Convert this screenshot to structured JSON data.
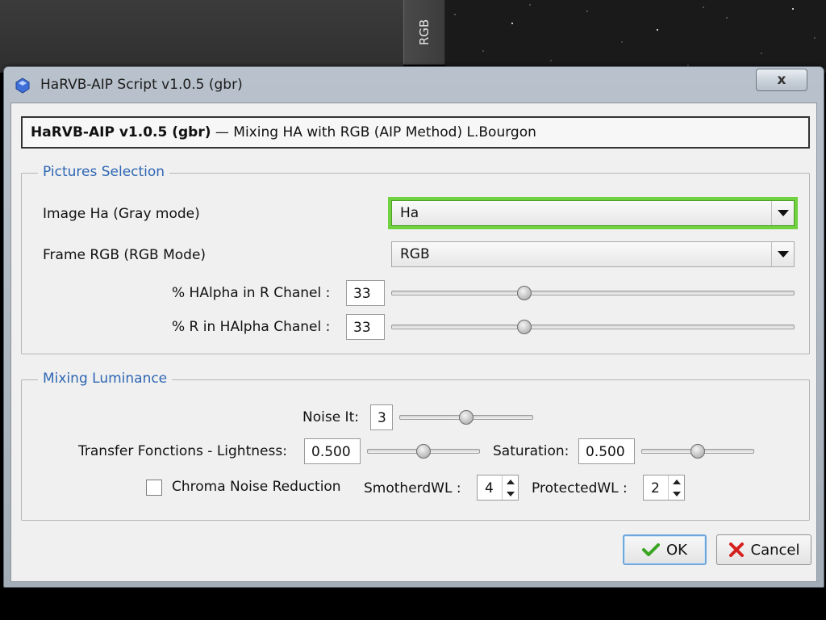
{
  "background": {
    "side_tab_label": "RGB"
  },
  "dialog": {
    "title": "HaRVB-AIP Script v1.0.5 (gbr)",
    "close_label": "x",
    "header": {
      "name": "HaRVB-AIP v1.0.5 (gbr)",
      "description": "— Mixing HA with RGB (AIP Method) L.Bourgon"
    },
    "pictures_selection": {
      "title": "Pictures Selection",
      "image_ha_label": "Image Ha (Gray mode)",
      "image_ha_value": "Ha",
      "frame_rgb_label": "Frame RGB (RGB Mode)",
      "frame_rgb_value": "RGB",
      "halpha_in_r_label": "% HAlpha in R Chanel :",
      "halpha_in_r_value": "33",
      "r_in_halpha_label": "% R in HAlpha Chanel :",
      "r_in_halpha_value": "33"
    },
    "mixing_luminance": {
      "title": "Mixing Luminance",
      "noise_label": "Noise It:",
      "noise_value": "3",
      "lightness_label": "Transfer Fonctions - Lightness:",
      "lightness_value": "0.500",
      "saturation_label": "Saturation:",
      "saturation_value": "0.500",
      "chroma_label": "Chroma Noise Reduction",
      "chroma_checked": false,
      "smothered_label": "SmotherdWL :",
      "smothered_value": "4",
      "protected_label": "ProtectedWL :",
      "protected_value": "2"
    },
    "buttons": {
      "ok_label": "OK",
      "cancel_label": "Cancel"
    }
  },
  "slider_levels": {
    "halpha_in_r": 0.33,
    "r_in_halpha": 0.33,
    "noise": 0.5,
    "lightness": 0.5,
    "saturation": 0.5
  },
  "colors": {
    "group_title": "#2f67b3",
    "focus_ring": "#6fd23e",
    "ok_check": "#3aa522",
    "cancel_x": "#d62020"
  }
}
